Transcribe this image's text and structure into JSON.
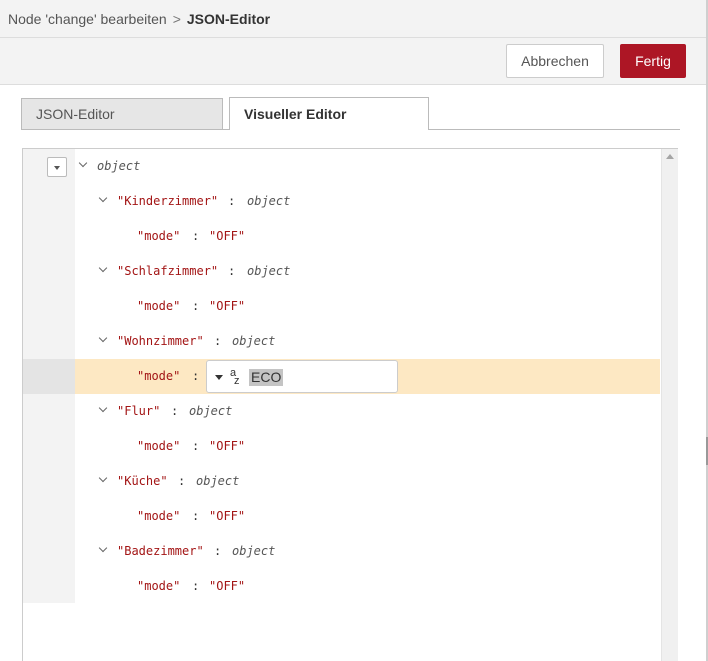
{
  "breadcrumb": {
    "parent": "Node 'change' bearbeiten",
    "separator": ">",
    "current": "JSON-Editor"
  },
  "toolbar": {
    "cancel_label": "Abbrechen",
    "done_label": "Fertig"
  },
  "tabs": [
    {
      "label": "JSON-Editor",
      "active": false
    },
    {
      "label": "Visueller Editor",
      "active": true
    }
  ],
  "tree": {
    "root_type": "object",
    "nodes": [
      {
        "key": "\"Kinderzimmer\"",
        "type": "object",
        "child_key": "\"mode\"",
        "child_value": "\"OFF\""
      },
      {
        "key": "\"Schlafzimmer\"",
        "type": "object",
        "child_key": "\"mode\"",
        "child_value": "\"OFF\""
      },
      {
        "key": "\"Wohnzimmer\"",
        "type": "object",
        "child_key": "\"mode\"",
        "child_value": "ECO",
        "editing": true
      },
      {
        "key": "\"Flur\"",
        "type": "object",
        "child_key": "\"mode\"",
        "child_value": "\"OFF\""
      },
      {
        "key": "\"Küche\"",
        "type": "object",
        "child_key": "\"mode\"",
        "child_value": "\"OFF\""
      },
      {
        "key": "\"Badezimmer\"",
        "type": "object",
        "child_key": "\"mode\"",
        "child_value": "\"OFF\""
      }
    ],
    "colon": ":",
    "string_type_icon": {
      "top": "a",
      "bottom": "z"
    }
  },
  "colors": {
    "primary_button": "#ad1625",
    "active_row": "#fde8c3",
    "key_color": "#a31515"
  }
}
